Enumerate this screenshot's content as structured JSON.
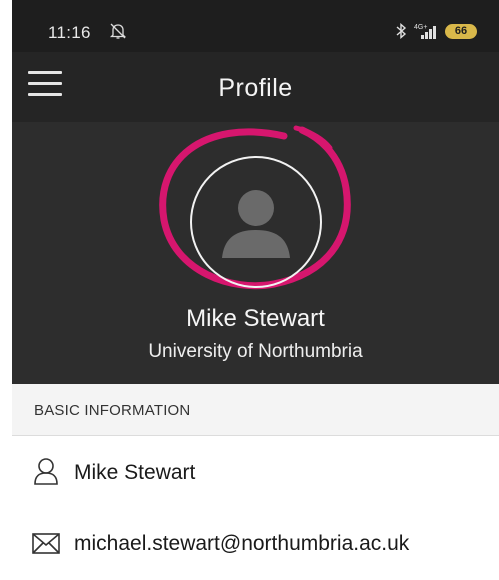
{
  "status_bar": {
    "time": "11:16",
    "network": "4G+",
    "battery": "66",
    "icons": [
      "bell-off-icon",
      "bluetooth-icon",
      "signal-icon",
      "battery-icon"
    ]
  },
  "app_bar": {
    "title": "Profile",
    "menu_icon": "hamburger-menu-icon"
  },
  "profile": {
    "name": "Mike Stewart",
    "organization": "University of Northumbria",
    "avatar_icon": "person-silhouette-icon"
  },
  "basic_info": {
    "header": "BASIC INFORMATION",
    "rows": [
      {
        "icon": "person-outline-icon",
        "value": "Mike Stewart"
      },
      {
        "icon": "envelope-icon",
        "value": "michael.stewart@northumbria.ac.uk"
      }
    ]
  },
  "colors": {
    "status_bar": "#1e1e1e",
    "app_bar": "#252525",
    "header": "#2d2d2d",
    "annotation": "#d6166e",
    "section_header": "#f4f4f4"
  }
}
